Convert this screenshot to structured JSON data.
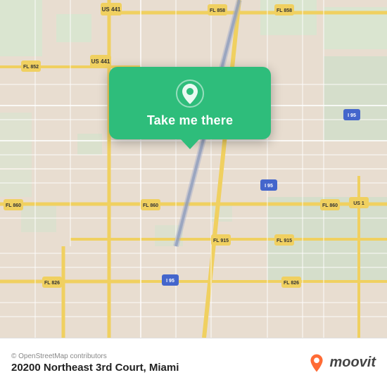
{
  "map": {
    "background_color": "#e8ddd0",
    "attribution": "© OpenStreetMap contributors"
  },
  "location_card": {
    "button_label": "Take me there",
    "pin_icon": "location-pin-icon"
  },
  "bottom_bar": {
    "copyright": "© OpenStreetMap contributors",
    "address": "20200 Northeast 3rd Court, Miami",
    "logo_text": "moovit"
  }
}
